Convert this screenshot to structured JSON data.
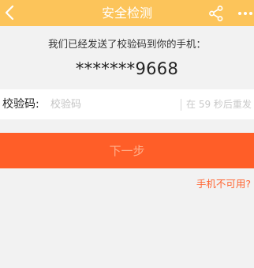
{
  "header": {
    "title": "安全检测",
    "background": "#fcc45a",
    "left_icon": "back-chevron-icon",
    "right_icons": [
      "share-icon",
      "more-icon"
    ]
  },
  "verification": {
    "info_text": "我们已经发送了校验码到你的手机：",
    "masked_phone": "*******9668"
  },
  "code_field": {
    "label": "校验码:",
    "placeholder": "校验码",
    "value": "",
    "resend_text": "在 59 秒后重发"
  },
  "next_button": {
    "label": "下一步",
    "color": "#ff5e28"
  },
  "phone_unavailable_link": "手机不可用?",
  "accent_color": "#ff6633"
}
